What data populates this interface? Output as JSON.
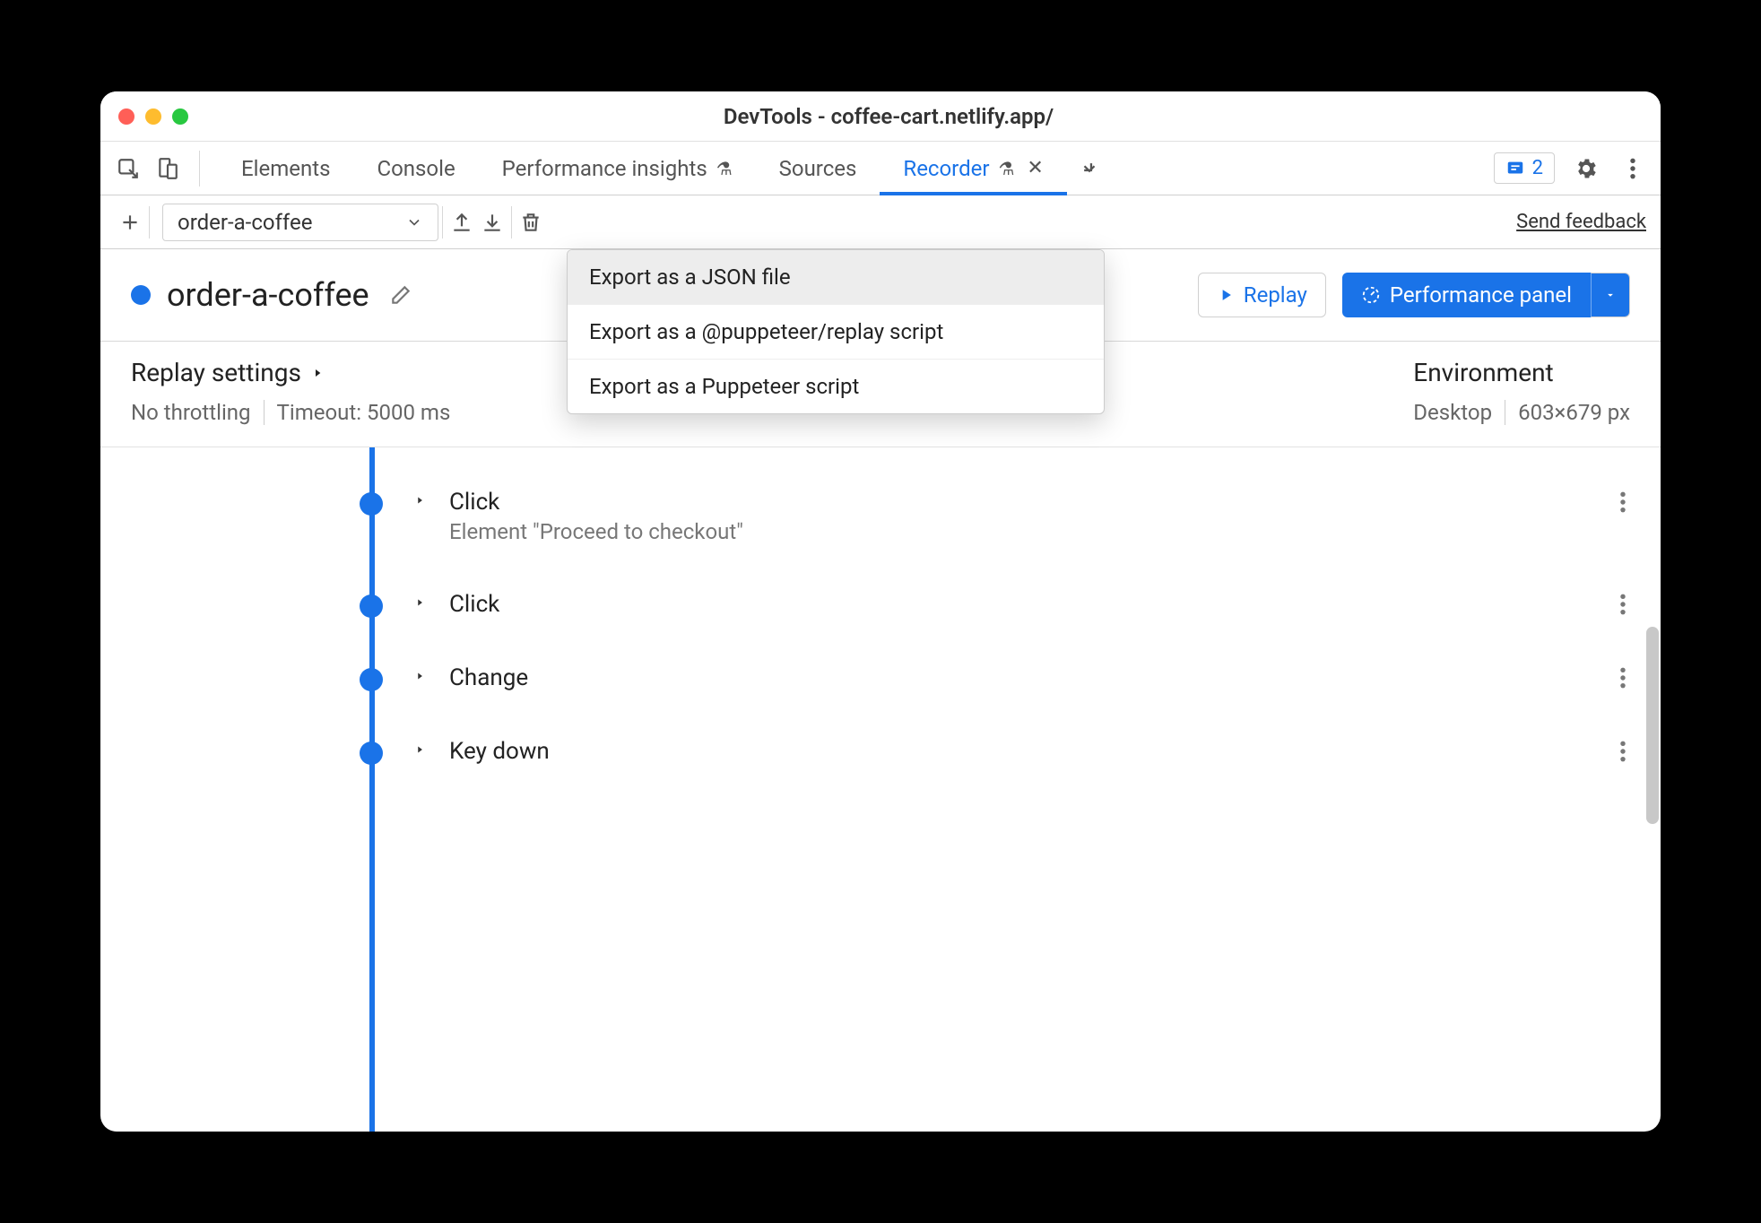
{
  "window": {
    "title": "DevTools - coffee-cart.netlify.app/"
  },
  "tabs": {
    "items": [
      "Elements",
      "Console",
      "Performance insights",
      "Sources",
      "Recorder"
    ],
    "active_index": 4,
    "issues_count": "2"
  },
  "toolbar": {
    "recording_name": "order-a-coffee",
    "send_feedback": "Send feedback"
  },
  "export_menu": {
    "items": [
      "Export as a JSON file",
      "Export as a @puppeteer/replay script",
      "Export as a Puppeteer script"
    ],
    "highlighted_index": 0
  },
  "header": {
    "title": "order-a-coffee",
    "replay_label": "Replay",
    "perf_panel_label": "Performance panel"
  },
  "settings": {
    "replay_title": "Replay settings",
    "throttling": "No throttling",
    "timeout": "Timeout: 5000 ms",
    "environment_title": "Environment",
    "device": "Desktop",
    "viewport": "603×679 px"
  },
  "steps": [
    {
      "name": "Click",
      "detail": "Element \"Proceed to checkout\""
    },
    {
      "name": "Click",
      "detail": ""
    },
    {
      "name": "Change",
      "detail": ""
    },
    {
      "name": "Key down",
      "detail": ""
    }
  ]
}
